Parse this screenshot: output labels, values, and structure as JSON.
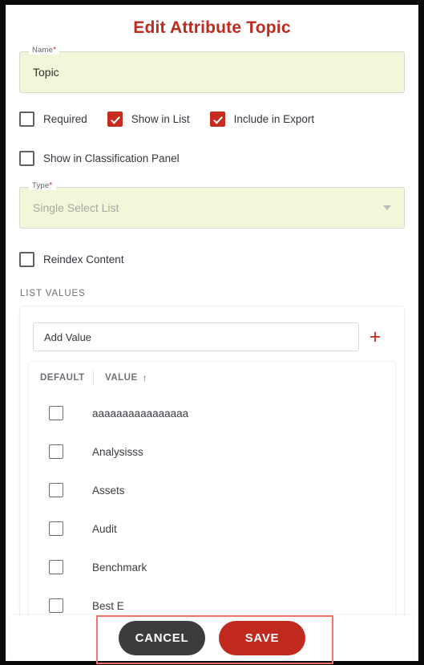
{
  "dialog": {
    "title": "Edit Attribute Topic"
  },
  "name_field": {
    "label": "Name",
    "required_marker": "*",
    "value": "Topic"
  },
  "type_field": {
    "label": "Type",
    "required_marker": "*",
    "value": "Single Select List",
    "caret_icon": "chevron-down-icon"
  },
  "options": {
    "row1": [
      {
        "label": "Required",
        "checked": false
      },
      {
        "label": "Show in List",
        "checked": true
      },
      {
        "label": "Include in Export",
        "checked": true
      }
    ],
    "row2": [
      {
        "label": "Show in Classification Panel",
        "checked": false
      }
    ],
    "row3": [
      {
        "label": "Reindex Content",
        "checked": false
      }
    ]
  },
  "list_values": {
    "section_label": "LIST VALUES",
    "add_input": {
      "value": "Add Value",
      "placeholder": "Add Value"
    },
    "add_button_icon": "plus-icon",
    "add_button_label": "+",
    "columns": {
      "default": "DEFAULT",
      "value": "VALUE",
      "sort_arrow": "↑"
    },
    "rows": [
      {
        "value": "aaaaaaaaaaaaaaaa",
        "default_checked": false
      },
      {
        "value": "Analysisss",
        "default_checked": false
      },
      {
        "value": "Assets",
        "default_checked": false
      },
      {
        "value": "Audit",
        "default_checked": false
      },
      {
        "value": "Benchmark",
        "default_checked": false
      },
      {
        "value": "Best E",
        "default_checked": false
      }
    ]
  },
  "actions": {
    "cancel_label": "CANCEL",
    "save_label": "SAVE"
  },
  "colors": {
    "brand_red": "#c02a1e",
    "title_red": "#bd2a20",
    "cancel_gray": "#3c3c3c",
    "field_yellow": "#f4f6d9",
    "annotation_red": "#f1746c"
  }
}
